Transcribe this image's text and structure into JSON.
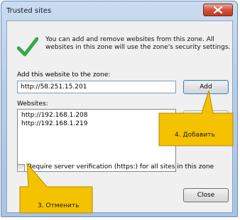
{
  "window": {
    "title": "Trusted sites"
  },
  "info_text": "You can add and remove websites from this zone. All websites in this zone will use the zone's security settings.",
  "add_section": {
    "label": "Add this website to the zone:",
    "value": "http://58.251.15.201",
    "add_label": "Add"
  },
  "websites": {
    "label": "Websites:",
    "items": [
      "http://192.168.1.208",
      "http://192.168.1.219"
    ]
  },
  "verification": {
    "label": "Require server verification (https:) for all sites in this zone",
    "checked": false
  },
  "close_label": "Close",
  "callouts": {
    "add_hint": "4. Добавить",
    "cancel_hint": "3. Отменить",
    "color": "#f5c200"
  }
}
